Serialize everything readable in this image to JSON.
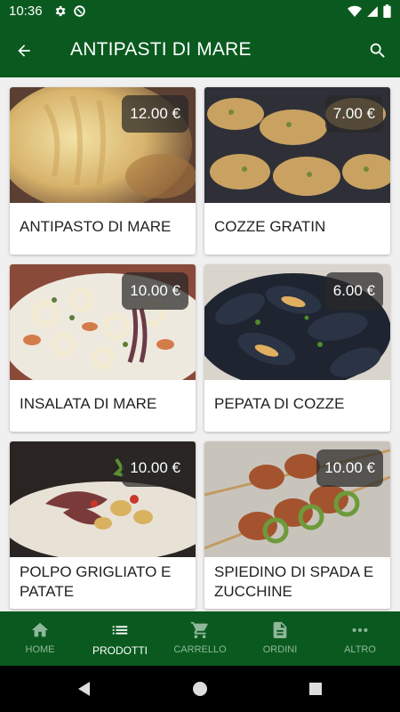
{
  "status_bar": {
    "time": "10:36",
    "icons": [
      "gear-icon",
      "data-saver-icon",
      "wifi-icon",
      "signal-icon",
      "battery-icon"
    ]
  },
  "app_bar": {
    "title": "ANTIPASTI DI MARE",
    "back_icon": "arrow-back-icon",
    "search_icon": "search-icon"
  },
  "products": [
    {
      "name": "ANTIPASTO DI MARE",
      "price": "12.00 €"
    },
    {
      "name": "COZZE GRATIN",
      "price": "7.00 €"
    },
    {
      "name": "INSALATA DI MARE",
      "price": "10.00 €"
    },
    {
      "name": "PEPATA DI COZZE",
      "price": "6.00 €"
    },
    {
      "name": "POLPO GRIGLIATO E PATATE",
      "price": "10.00 €"
    },
    {
      "name": "SPIEDINO DI SPADA E ZUCCHINE",
      "price": "10.00 €"
    }
  ],
  "bottom_nav": {
    "items": [
      {
        "label": "HOME",
        "icon": "home-icon",
        "active": false
      },
      {
        "label": "PRODOTTI",
        "icon": "list-icon",
        "active": true
      },
      {
        "label": "CARRELLO",
        "icon": "cart-icon",
        "active": false
      },
      {
        "label": "ORDINI",
        "icon": "document-icon",
        "active": false
      },
      {
        "label": "ALTRO",
        "icon": "more-icon",
        "active": false
      }
    ]
  },
  "colors": {
    "primary": "#0a5a1f",
    "nav_inactive": "#8fb79a",
    "background": "#f0f0f0"
  }
}
